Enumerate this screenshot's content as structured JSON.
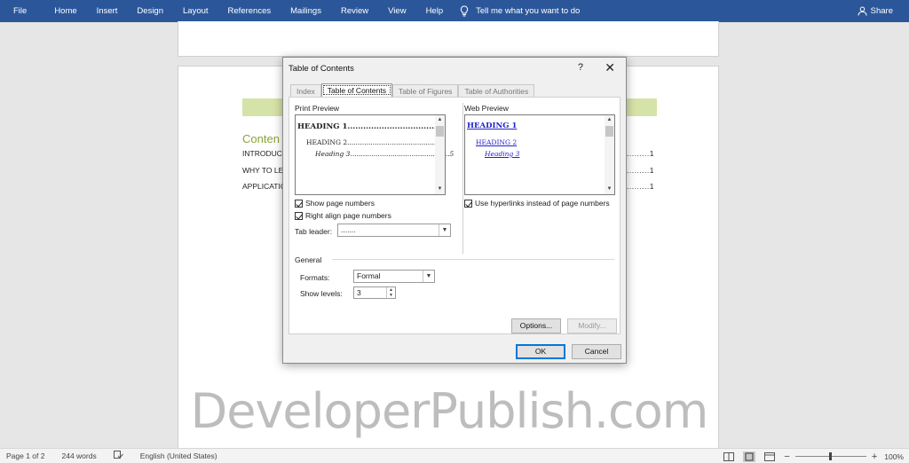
{
  "ribbon": {
    "tabs": [
      "File",
      "Home",
      "Insert",
      "Design",
      "Layout",
      "References",
      "Mailings",
      "Review",
      "View",
      "Help"
    ],
    "tell_me": "Tell me what you want to do",
    "share": "Share"
  },
  "document": {
    "heading": "Conten",
    "lines": [
      "INTRODUC",
      "WHY TO LE",
      "APPLICATIO"
    ],
    "page_nums": [
      "1",
      "1",
      "1"
    ],
    "watermark": "DeveloperPublish.com"
  },
  "dialog": {
    "title": "Table of Contents",
    "help": "?",
    "close": "✕",
    "tabs": [
      "Index",
      "Table of Contents",
      "Table of Figures",
      "Table of Authorities"
    ],
    "print_preview": {
      "label": "Print Preview",
      "lines": [
        {
          "text": "HEADING 1",
          "dots": "..................................",
          "page": "1"
        },
        {
          "text": "HEADING 2",
          "dots": "..........................................",
          "page": "3"
        },
        {
          "text": "Heading 3",
          "dots": "...............................................",
          "page": "5"
        }
      ]
    },
    "web_preview": {
      "label": "Web Preview",
      "lines": [
        "HEADING 1",
        "HEADING 2",
        "Heading 3"
      ]
    },
    "show_page_numbers": "Show page numbers",
    "right_align": "Right align page numbers",
    "use_hyperlinks": "Use hyperlinks instead of page numbers",
    "tab_leader_label": "Tab leader:",
    "tab_leader_value": ".......",
    "general_label": "General",
    "formats_label": "Formats:",
    "formats_value": "Formal",
    "show_levels_label": "Show levels:",
    "show_levels_value": "3",
    "options_button": "Options...",
    "modify_button": "Modify...",
    "ok_button": "OK",
    "cancel_button": "Cancel"
  },
  "statusbar": {
    "page": "Page 1 of 2",
    "words": "244 words",
    "language": "English (United States)",
    "zoom_minus": "−",
    "zoom_plus": "+",
    "zoom": "100%"
  }
}
